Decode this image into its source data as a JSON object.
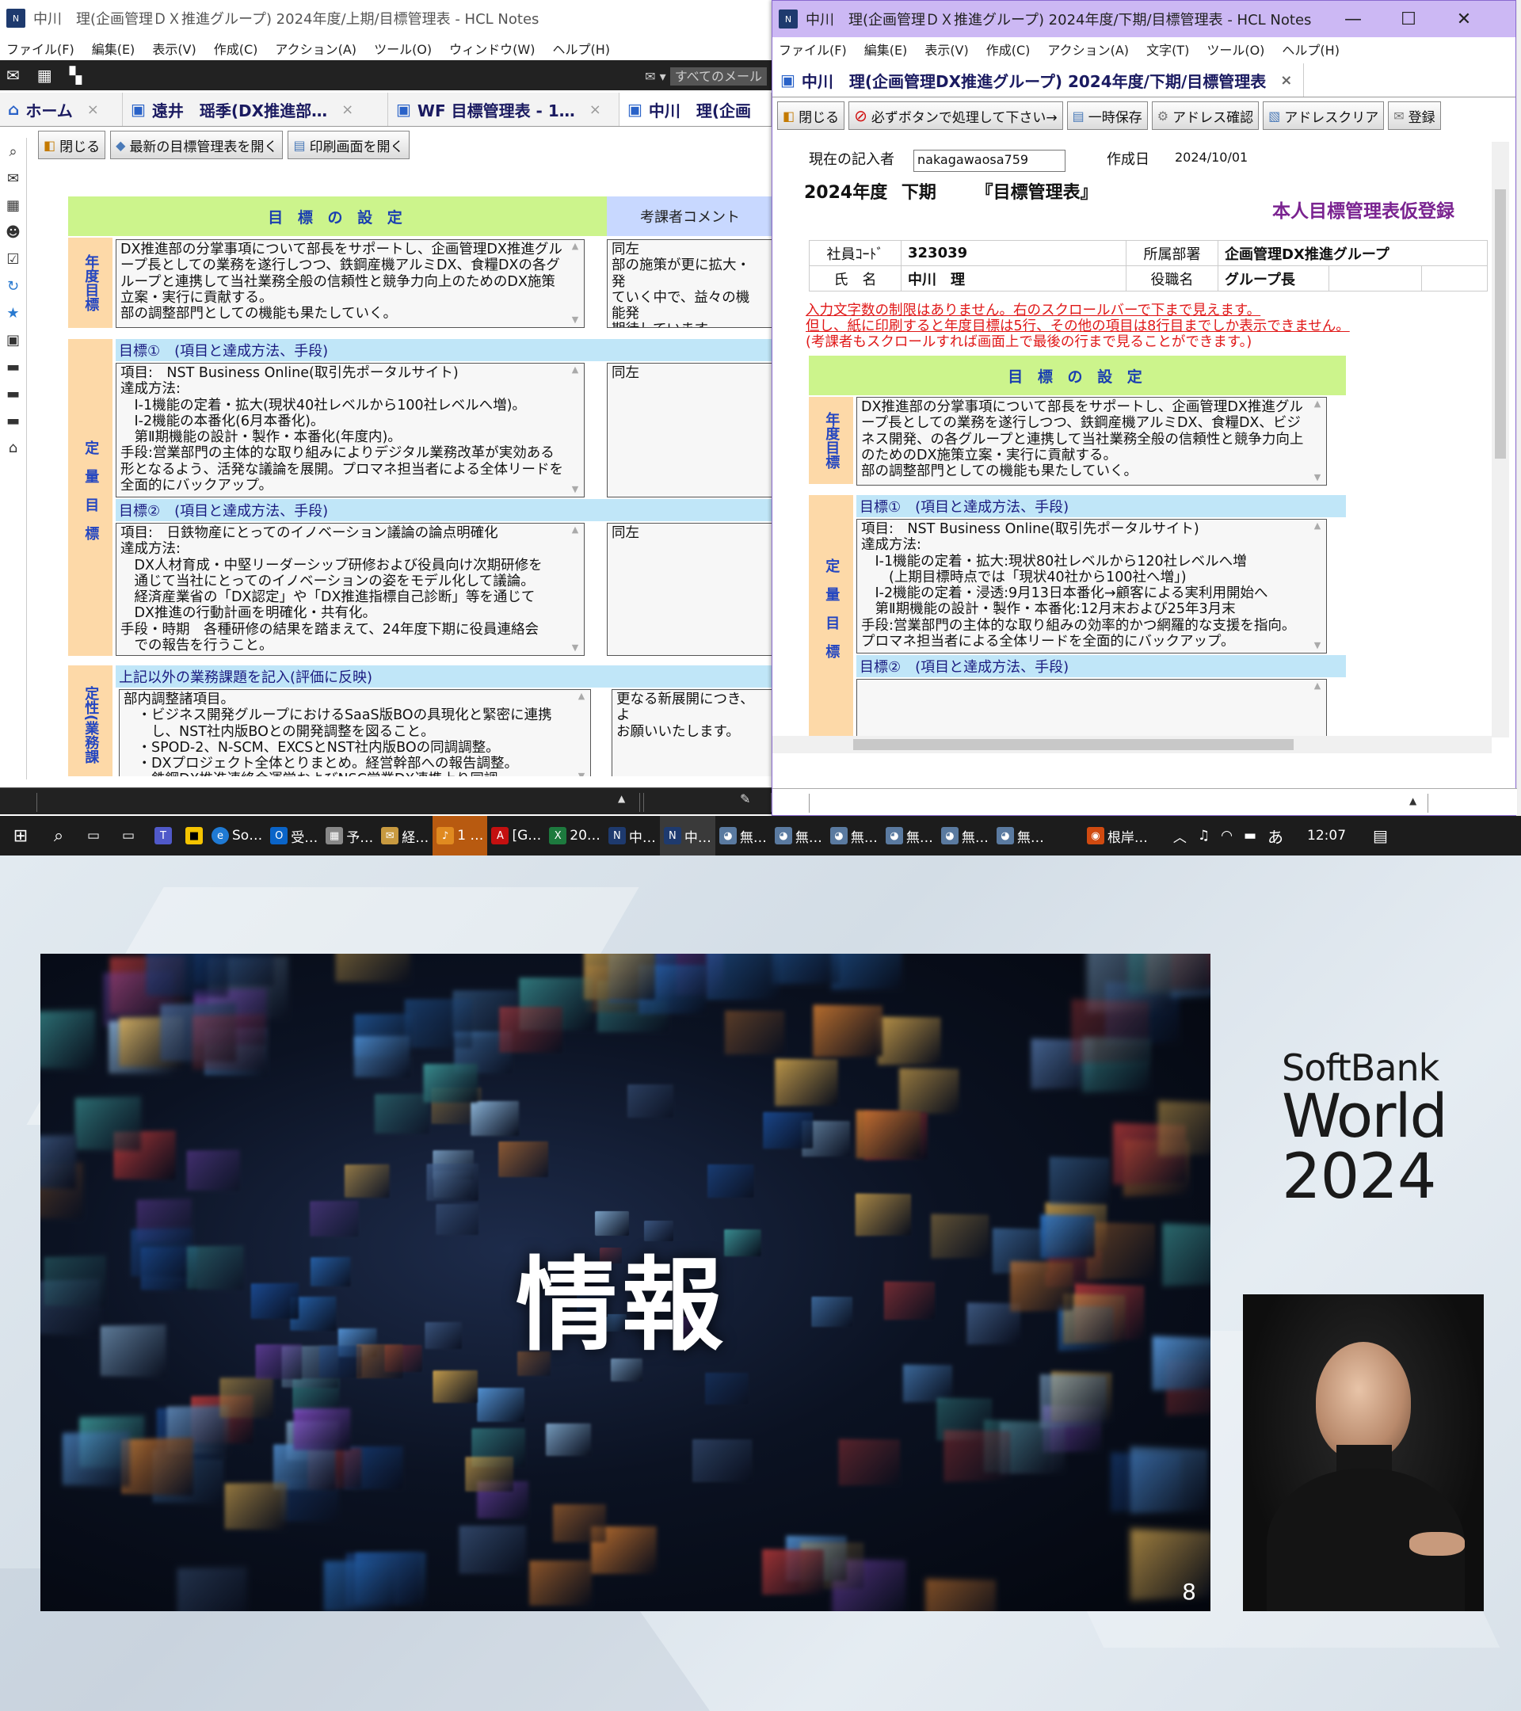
{
  "win1": {
    "title": "中川　理(企画管理ＤＸ推進グループ)  2024年度/上期/目標管理表 - HCL Notes",
    "menu": [
      "ファイル(F)",
      "編集(E)",
      "表示(V)",
      "作成(C)",
      "アクション(A)",
      "ツール(O)",
      "ウィンドウ(W)",
      "ヘルプ(H)"
    ],
    "mail_label": "すべてのメール",
    "tabs": [
      {
        "label": "ホーム"
      },
      {
        "label": "遠井　瑶季(DX推進部…"
      },
      {
        "label": "WF 目標管理表 - 1…"
      },
      {
        "label": "中川　理(企画"
      }
    ],
    "toolbar": {
      "close": "閉じる",
      "open_latest": "最新の目標管理表を開く",
      "print_screen": "印刷画面を開く"
    },
    "form": {
      "goal_header": "目 標 の 設 定",
      "comment_header": "考課者コメント",
      "annual_label": "年度目標",
      "annual_text": "DX推進部の分掌事項について部長をサポートし、企画管理DX推進グループ長としての業務を遂行しつつ、鉄鋼産機アルミDX、食糧DXの各グループと連携して当社業務全般の信頼性と競争力向上のためのDX施策立案・実行に貢献する。\n部の調整部門としての機能も果たしていく。",
      "annual_comment": "同左\n部の施策が更に拡大・発\nていく中で、益々の機能発\n期待しています。",
      "quant_label": "定量目標",
      "goal1_head": "目標①　(項目と達成方法、手段)",
      "goal1_text": "項目:　NST Business Online(取引先ポータルサイト)\n達成方法:\n　Ⅰ-1機能の定着・拡大(現状40社レベルから100社レベルへ増)。\n　Ⅰ-2機能の本番化(6月本番化)。\n　第Ⅱ期機能の設計・製作・本番化(年度内)。\n手段:営業部門の主体的な取り組みによりデジタル業務改革が実効ある形となるよう、活発な議論を展開。プロマネ担当者による全体リードを全面的にバックアップ。",
      "goal1_comment": "同左",
      "goal2_head": "目標②　(項目と達成方法、手段)",
      "goal2_text": "項目:　日鉄物産にとってのイノベーション議論の論点明確化\n達成方法:\n　DX人材育成・中堅リーダーシップ研修および役員向け次期研修を\n　通じて当社にとってのイノベーションの姿をモデル化して議論。\n　経済産業省の「DX認定」や「DX推進指標自己診断」等を通じて\n　DX推進の行動計画を明確化・共有化。\n手段・時期　各種研修の結果を踏まえて、24年度下期に役員連絡会\n　での報告を行うこと。",
      "goal2_comment": "同左",
      "other_head": "上記以外の業務課題を記入(評価に反映)",
      "qual_label": "定性(業務課",
      "other_text": "部内調整諸項目。\n　・ビジネス開発グループにおけるSaaS版BOの具現化と緊密に連携\n　　し、NST社内版BOとの開発調整を図ること。\n　・SPOD-2、N-SCM、EXCSとNST社内版BOの同調調整。\n　・DXプロジェクト全体とりまとめ。経営幹部への報告調整。\n　　鉄鋼DX推進連絡会運営およびNSC営業DX連携上り同調",
      "other_comment": "更なる新展開につき、よ\nお願いいたします。"
    }
  },
  "win2": {
    "title": "中川　理(企画管理ＤＸ推進グループ)  2024年度/下期/目標管理表 - HCL Notes",
    "menu": [
      "ファイル(F)",
      "編集(E)",
      "表示(V)",
      "作成(C)",
      "アクション(A)",
      "文字(T)",
      "ツール(O)",
      "ヘルプ(H)"
    ],
    "tab_label": "中川　理(企画管理DX推進グループ)  2024年度/下期/目標管理表",
    "toolbar": {
      "close": "閉じる",
      "must_button": "必ずボタンで処理して下さい→",
      "temp_save": "一時保存",
      "address_check": "アドレス確認",
      "address_clear": "アドレスクリア",
      "register": "登録"
    },
    "form": {
      "writer_label": "現在の記入者",
      "writer_value": "nakagawaosa759",
      "created_label": "作成日",
      "created_value": "2024/10/01",
      "year": "2024年度",
      "period": "下期",
      "doc_title": "『目標管理表』",
      "status": "本人目標管理表仮登録",
      "emp_code_label": "社員ｺｰﾄﾞ",
      "emp_code": "323039",
      "dept_label": "所属部署",
      "dept": "企画管理DX推進グループ",
      "name_label": "氏　名",
      "name": "中川　理",
      "position_label": "役職名",
      "position": "グループ長",
      "notice_1": "入力文字数の制限はありません。右のスクロールバーで下まで見えます。",
      "notice_2": "但し、紙に印刷すると年度目標は5行、その他の項目は8行目までしか表示できません。",
      "notice_3": "(考課者もスクロールすれば画面上で最後の行まで見ることができます。)",
      "goal_header": "目 標 の 設 定",
      "annual_label": "年度目標",
      "annual_text": "DX推進部の分掌事項について部長をサポートし、企画管理DX推進グループ長としての業務を遂行しつつ、鉄鋼産機アルミDX、食糧DX、ビジネス開発、の各グループと連携して当社業務全般の信頼性と競争力向上のためのDX施策立案・実行に貢献する。\n部の調整部門としての機能も果たしていく。",
      "quant_label": "定量目標",
      "goal1_head": "目標①　(項目と達成方法、手段)",
      "goal1_text": "項目:　NST Business Online(取引先ポータルサイト)\n達成方法:\n　Ⅰ-1機能の定着・拡大:現状80社レベルから120社レベルへ増\n　　(上期目標時点では「現状40社から100社へ増」)\n　Ⅰ-2機能の定着・浸透:9月13日本番化→顧客による実利用開始へ\n　第Ⅱ期機能の設計・製作・本番化:12月末および25年3月末\n手段:営業部門の主体的な取り組みの効率的かつ網羅的な支援を指向。プロマネ担当者による全体リードを全面的にバックアップ。",
      "goal2_head": "目標②　(項目と達成方法、手段)"
    }
  },
  "taskbar": {
    "items": [
      "So…",
      "受…",
      "予…",
      "経…",
      "1 …",
      "[G…",
      "20…",
      "中…",
      "中…",
      "無…",
      "無…",
      "無…",
      "無…",
      "無…",
      "無…"
    ],
    "user": "根岸…",
    "ime": "あ",
    "time": "12:07"
  },
  "presentation": {
    "slide_title": "情報",
    "page_number": "8",
    "logo_line1": "SoftBank",
    "logo_line2": "World",
    "logo_line3": "2024"
  }
}
